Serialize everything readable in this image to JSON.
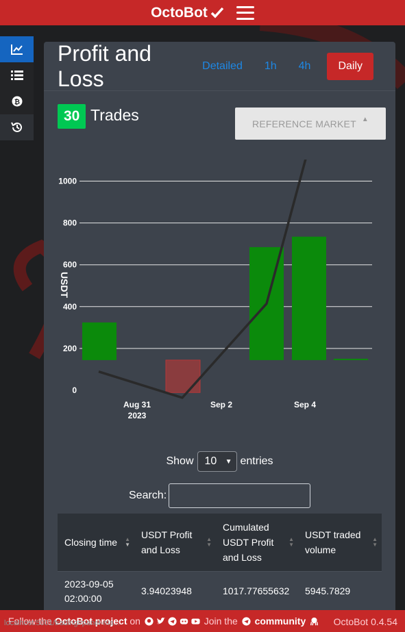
{
  "header": {
    "brand": "OctoBot"
  },
  "sidebar": {
    "items": [
      "chart",
      "list",
      "bitcoin",
      "history"
    ]
  },
  "card": {
    "title": "Profit and Loss",
    "timeframes": [
      "Detailed",
      "1h",
      "4h",
      "Daily"
    ],
    "active_timeframe": "Daily",
    "trades_count": "30",
    "trades_label": "Trades",
    "reference_market": "REFERENCE MARKET"
  },
  "chart_data": {
    "type": "bar",
    "ylabel": "USDT",
    "yticks": [
      "0",
      "200",
      "400",
      "600",
      "800",
      "1000"
    ],
    "xticks": [
      "Aug 31\n2023",
      "Sep 2",
      "Sep 4"
    ],
    "ylim": [
      0,
      1000
    ],
    "grid": true,
    "categories": [
      "2023-08-31",
      "2023-09-01",
      "2023-09-02",
      "2023-09-03",
      "2023-09-04",
      "2023-09-05"
    ],
    "series": [
      {
        "type": "bar",
        "values": [
          180,
          0,
          -155,
          540,
          590,
          3.94
        ],
        "colors": [
          "#0b8a0b",
          null,
          "#a43a3a",
          "#0b8a0b",
          "#0b8a0b",
          "#0b8a0b"
        ]
      },
      {
        "type": "line",
        "values": [
          -55,
          0,
          -180,
          270,
          1010,
          1017.78
        ],
        "color": "#2a2a2a"
      }
    ]
  },
  "table": {
    "show_label": "Show",
    "entries_value": "10",
    "entries_label": "entries",
    "search_label": "Search:",
    "headers": [
      "Closing time",
      "USDT Profit and Loss",
      "Cumulated USDT Profit and Loss",
      "USDT traded volume"
    ],
    "rows": [
      [
        "2023-09-05 02:00:00",
        "3.94023948",
        "1017.77655632",
        "5945.7829"
      ]
    ]
  },
  "footer": {
    "follow_text": "Follow the",
    "project_link": "OctoBot project",
    "on_text": "on",
    "join_text": "Join the",
    "community_link": "community",
    "version": "OctoBot 0.4.54",
    "status_url": "localhost:5001/trading#panel-ma..."
  }
}
